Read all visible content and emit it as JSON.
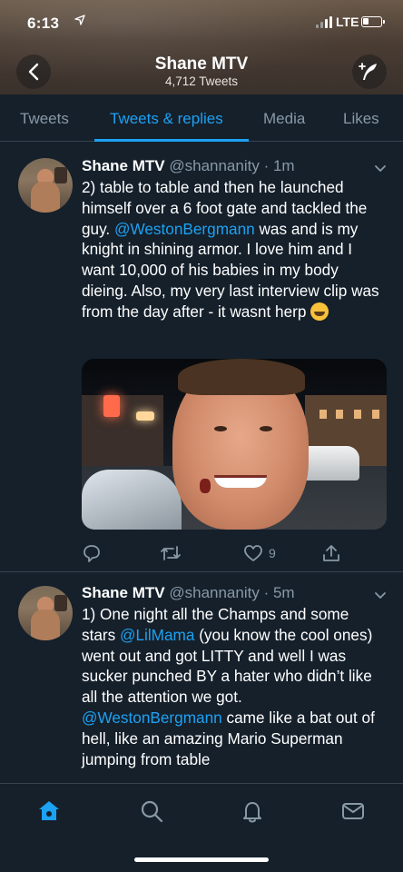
{
  "status_bar": {
    "time": "6:13",
    "network": "LTE"
  },
  "header": {
    "title": "Shane MTV",
    "subtitle": "4,712 Tweets"
  },
  "tabs": [
    {
      "label": "Tweets",
      "active": false
    },
    {
      "label": "Tweets & replies",
      "active": true
    },
    {
      "label": "Media",
      "active": false
    },
    {
      "label": "Likes",
      "active": false
    }
  ],
  "tweets": [
    {
      "name": "Shane MTV",
      "handle": "@shannanity",
      "time": "1m",
      "text": {
        "part1": "2) table to table and then he launched himself over a 6 foot gate and tackled the guy. ",
        "mention": "@WestonBergmann",
        "part2": " was and is my knight in shining armor. I love him and I want 10,000 of his babies in my body dieing. Also, my very last interview clip was from the day after - it wasnt herp "
      },
      "emoji": "face-with-tears-of-joy",
      "media": "photo",
      "likes": "9"
    },
    {
      "name": "Shane MTV",
      "handle": "@shannanity",
      "time": "5m",
      "text": {
        "part1": "1) One night all the Champs and some stars ",
        "mention1": "@LilMama",
        "part2": " (you know the cool ones) went out and got LITTY and well I was sucker punched BY a hater who didn’t like all the attention we got. ",
        "mention2": "@WestonBergmann",
        "part3": " came like a bat out of hell, like an amazing Mario Superman jumping from table"
      }
    }
  ],
  "colors": {
    "accent": "#1da1f2",
    "background": "#15202b",
    "muted": "#8899a6",
    "divider": "#38444d"
  },
  "icons": {
    "header": [
      "back-arrow-icon",
      "compose-icon"
    ],
    "tweet_actions": [
      "reply-icon",
      "retweet-icon",
      "like-icon",
      "share-icon"
    ],
    "tab_bar": [
      "home-icon",
      "search-icon",
      "notifications-icon",
      "messages-icon"
    ]
  }
}
